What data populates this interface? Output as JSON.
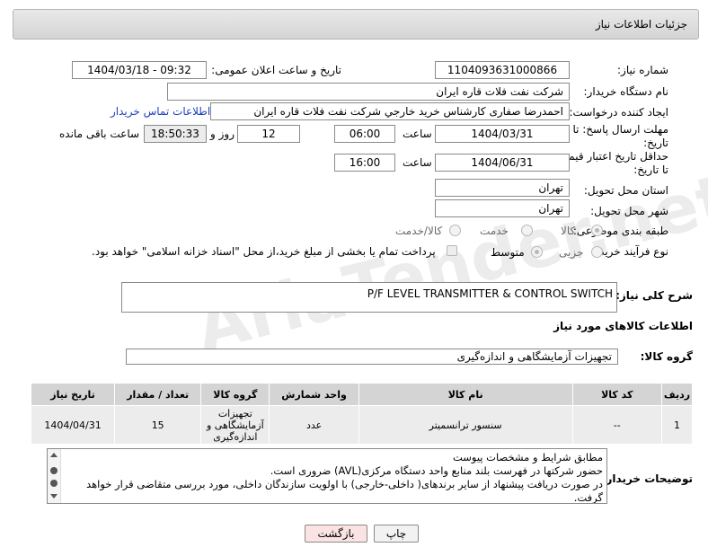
{
  "header": {
    "title": "جزئیات اطلاعات نیاز"
  },
  "fields": {
    "need_number_label": "شماره نیاز:",
    "need_number": "1104093631000866",
    "announce_label": "تاریخ و ساعت اعلان عمومی:",
    "announce_value": "1404/03/18 - 09:32",
    "buyer_org_label": "نام دستگاه خریدار:",
    "buyer_org": "شرکت نفت فلات قاره ایران",
    "creator_label": "ایجاد کننده درخواست:",
    "creator": "احمدرضا صفاری کارشناس خرید خارجي شركت نفت فلات قاره ايران",
    "contact_link": "اطلاعات تماس خریدار",
    "deadline_label_1": "مهلت ارسال پاسخ: تا",
    "deadline_label_2": "تاریخ:",
    "deadline_date": "1404/03/31",
    "time_word": "ساعت",
    "deadline_time": "06:00",
    "days_value": "12",
    "days_word": "روز و",
    "remaining_time": "18:50:33",
    "remaining_word": "ساعت باقی مانده",
    "validity_label_1": "حداقل تاریخ اعتبار قیمت:",
    "validity_label_2": "تا تاریخ:",
    "validity_date": "1404/06/31",
    "validity_time": "16:00",
    "province_label": "استان محل تحویل:",
    "province": "تهران",
    "city_label": "شهر محل تحویل:",
    "city": "تهران",
    "category_label": "طبقه بندی موضوعی:",
    "category_options": [
      "کالا",
      "خدمت",
      "کالا/خدمت"
    ],
    "process_label": "نوع فرآیند خرید :",
    "process_options": [
      "جزیی",
      "متوسط"
    ],
    "payment_note": "پرداخت تمام یا بخشی از مبلغ خرید،از محل \"اسناد خزانه اسلامی\" خواهد بود."
  },
  "description": {
    "label": "شرح کلی نیاز:",
    "value": "P/F LEVEL TRANSMITTER & CONTROL SWITCH"
  },
  "goods_section": {
    "title": "اطلاعات کالاهای مورد نیاز",
    "group_label": "گروه کالا:",
    "group_value": "تجهیزات آزمایشگاهی و اندازه‌گیری"
  },
  "table": {
    "headers": [
      "ردیف",
      "کد کالا",
      "نام کالا",
      "واحد شمارش",
      "گروه کالا",
      "تعداد / مقدار",
      "تاریخ نیاز"
    ],
    "rows": [
      {
        "row": "1",
        "code": "--",
        "name": "سنسور ترانسمیتر",
        "unit": "عدد",
        "group": "تجهیزات آزمایشگاهی و اندازه‌گیری",
        "qty": "15",
        "date": "1404/04/31"
      }
    ]
  },
  "buyer_notes": {
    "label": "توضیحات خریدار:",
    "lines": [
      "مطابق شرایط و  مشخصات پیوست",
      "حضور شرکتها در فهرست بلند منابع واحد دستگاه مرکزی(AVL) ضروری است.",
      "در صورت دریافت پیشنهاد از سایر برندهای( داخلی-خارجی) با اولویت سازندگان داخلی، مورد بررسی متقاضی قرار خواهد گرفت."
    ]
  },
  "buttons": {
    "print": "چاپ",
    "back": "بازگشت"
  },
  "watermark": "AriaTender.net"
}
